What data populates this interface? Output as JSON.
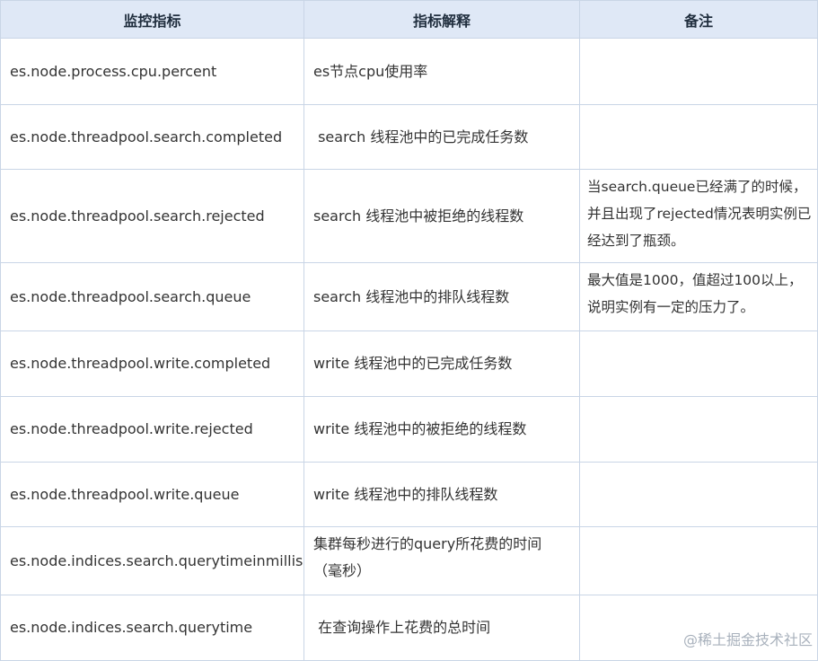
{
  "headers": [
    "监控指标",
    "指标解释",
    "备注"
  ],
  "rows": [
    {
      "metric": "es.node.process.cpu.percent",
      "desc": "es节点cpu使用率",
      "note": ""
    },
    {
      "metric": "es.node.threadpool.search.completed",
      "desc": " search 线程池中的已完成任务数",
      "note": ""
    },
    {
      "metric": "es.node.threadpool.search.rejected",
      "desc": "search 线程池中被拒绝的线程数",
      "note": "当search.queue已经满了的时候，并且出现了rejected情况表明实例已经达到了瓶颈。"
    },
    {
      "metric": "es.node.threadpool.search.queue",
      "desc": "search 线程池中的排队线程数",
      "note": "最大值是1000，值超过100以上，说明实例有一定的压力了。"
    },
    {
      "metric": "es.node.threadpool.write.completed",
      "desc": "write 线程池中的已完成任务数",
      "note": ""
    },
    {
      "metric": "es.node.threadpool.write.rejected",
      "desc": "write 线程池中的被拒绝的线程数",
      "note": ""
    },
    {
      "metric": "es.node.threadpool.write.queue",
      "desc": "write 线程池中的排队线程数",
      "note": ""
    },
    {
      "metric": "es.node.indices.search.querytimeinmillis",
      "desc": "集群每秒进行的query所花费的时间（毫秒）",
      "note": ""
    },
    {
      "metric": "es.node.indices.search.querytime",
      "desc": " 在查询操作上花费的总时间",
      "note": ""
    }
  ],
  "watermark": "@稀土掘金技术社区"
}
